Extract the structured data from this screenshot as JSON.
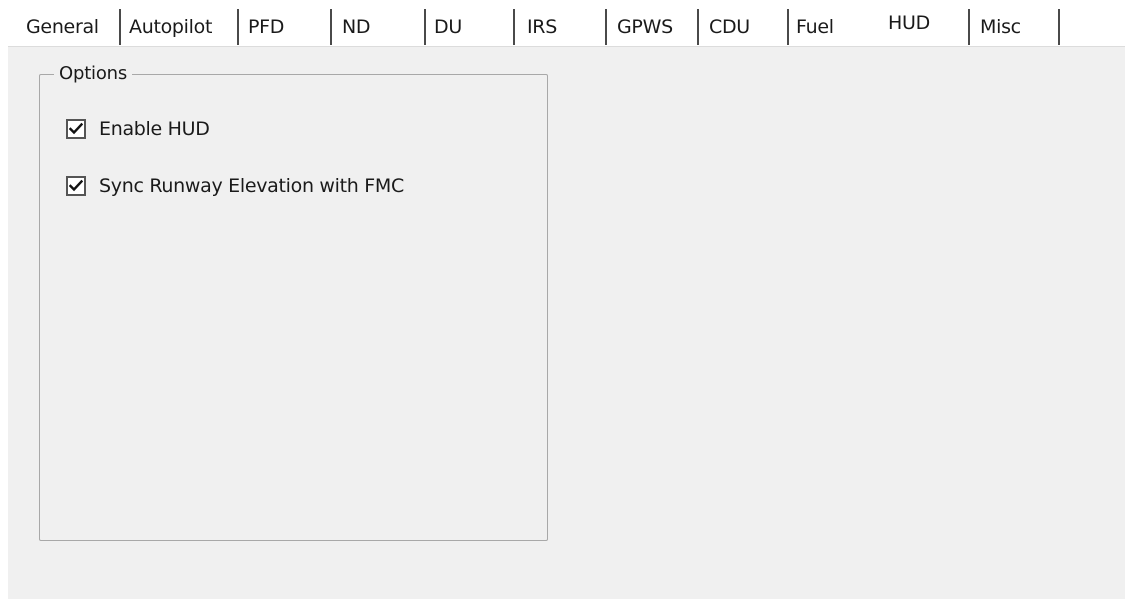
{
  "tabs": [
    {
      "label": "General"
    },
    {
      "label": "Autopilot"
    },
    {
      "label": "PFD"
    },
    {
      "label": "ND"
    },
    {
      "label": "DU"
    },
    {
      "label": "IRS"
    },
    {
      "label": "GPWS"
    },
    {
      "label": "CDU"
    },
    {
      "label": "Fuel"
    },
    {
      "label": "HUD"
    },
    {
      "label": "Misc"
    }
  ],
  "selected_tab": "HUD",
  "options_group": {
    "title": "Options",
    "checkboxes": [
      {
        "label": "Enable HUD",
        "checked": true
      },
      {
        "label": "Sync Runway Elevation with FMC",
        "checked": true
      }
    ]
  },
  "icons": {
    "checkmark": "checkmark-icon"
  },
  "colors": {
    "panel_background": "#f0f0f0",
    "tab_background": "#ffffff",
    "group_border": "#a8a8a8",
    "checkbox_border": "#555555"
  }
}
